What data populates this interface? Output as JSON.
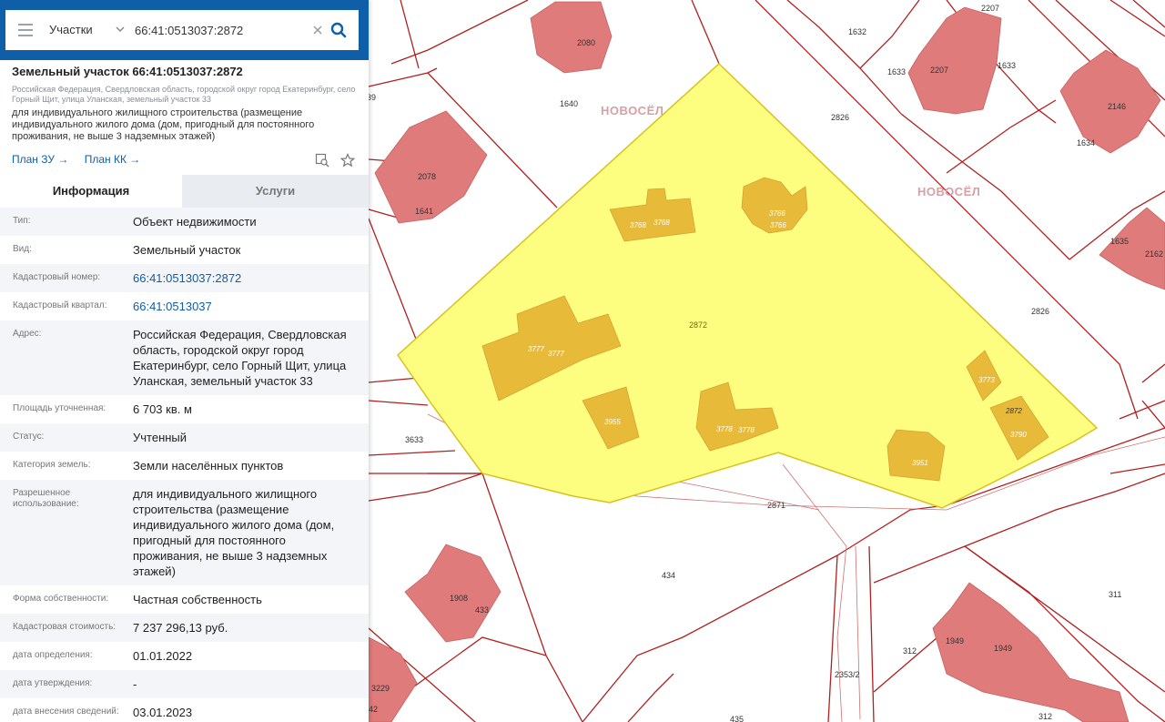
{
  "search": {
    "layer": "Участки",
    "query": "66:41:0513037:2872"
  },
  "object": {
    "title": "Земельный участок 66:41:0513037:2872",
    "address_short": "Российская Федерация, Свердловская область, городской округ город Екатеринбург, село Горный Щит, улица Уланская, земельный участок 33",
    "purpose": "для индивидуального жилищного строительства (размещение индивидуального жилого дома (дом, пригодный для постоянного проживания, не выше 3 надземных этажей)",
    "links": [
      "План ЗУ →",
      "План КК →"
    ]
  },
  "tabs": [
    "Информация",
    "Услуги"
  ],
  "info": [
    {
      "k": "Тип:",
      "v": "Объект недвижимости"
    },
    {
      "k": "Вид:",
      "v": "Земельный участок"
    },
    {
      "k": "Кадастровый номер:",
      "v": "66:41:0513037:2872",
      "link": true
    },
    {
      "k": "Кадастровый квартал:",
      "v": "66:41:0513037",
      "link": true
    },
    {
      "k": "Адрес:",
      "v": "Российская Федерация, Свердловская область, городской округ город Екатеринбург, село Горный Щит, улица Уланская, земельный участок 33"
    },
    {
      "k": "Площадь уточненная:",
      "v": "6 703 кв. м"
    },
    {
      "k": "Статус:",
      "v": "Учтенный"
    },
    {
      "k": "Категория земель:",
      "v": "Земли населённых пунктов"
    },
    {
      "k": "Разрешенное использование:",
      "v": "для индивидуального жилищного строительства (размещение индивидуального жилого дома (дом, пригодный для постоянного проживания, не выше 3 надземных этажей)"
    },
    {
      "k": "Форма собственности:",
      "v": "Частная собственность"
    },
    {
      "k": "Кадастровая стоимость:",
      "v": "7 237 296,13 руб."
    },
    {
      "k": "дата определения:",
      "v": "01.01.2022"
    },
    {
      "k": "дата утверждения:",
      "v": "-"
    },
    {
      "k": "дата внесения сведений:",
      "v": "03.01.2023"
    }
  ],
  "map": {
    "selected_parcel": "2872",
    "parcel_labels": [
      "2080",
      "1640",
      "1632",
      "2207",
      "2207",
      "1633",
      "1633",
      "2146",
      "2078",
      "1641",
      "2826",
      "1634",
      "1635",
      "2162",
      "2826",
      "3633",
      "2871",
      "434",
      "311",
      "1908",
      "433",
      "312",
      "1949",
      "1949",
      "3229",
      "2353/2",
      "312",
      "435",
      "39",
      "42"
    ],
    "building_labels": [
      "3768",
      "3768",
      "3766",
      "3766",
      "3777",
      "3777",
      "3955",
      "3778",
      "3778",
      "3773",
      "2872",
      "3790",
      "3951"
    ],
    "watermark": "НОВОСЁЛ",
    "colors": {
      "selected_fill": "#fdfd80",
      "selected_stroke": "#d8c21a",
      "building": "#e8ba3a",
      "house": "#e07b7b",
      "parcel_line": "#b02020",
      "brand": "#0e5ea8"
    }
  }
}
